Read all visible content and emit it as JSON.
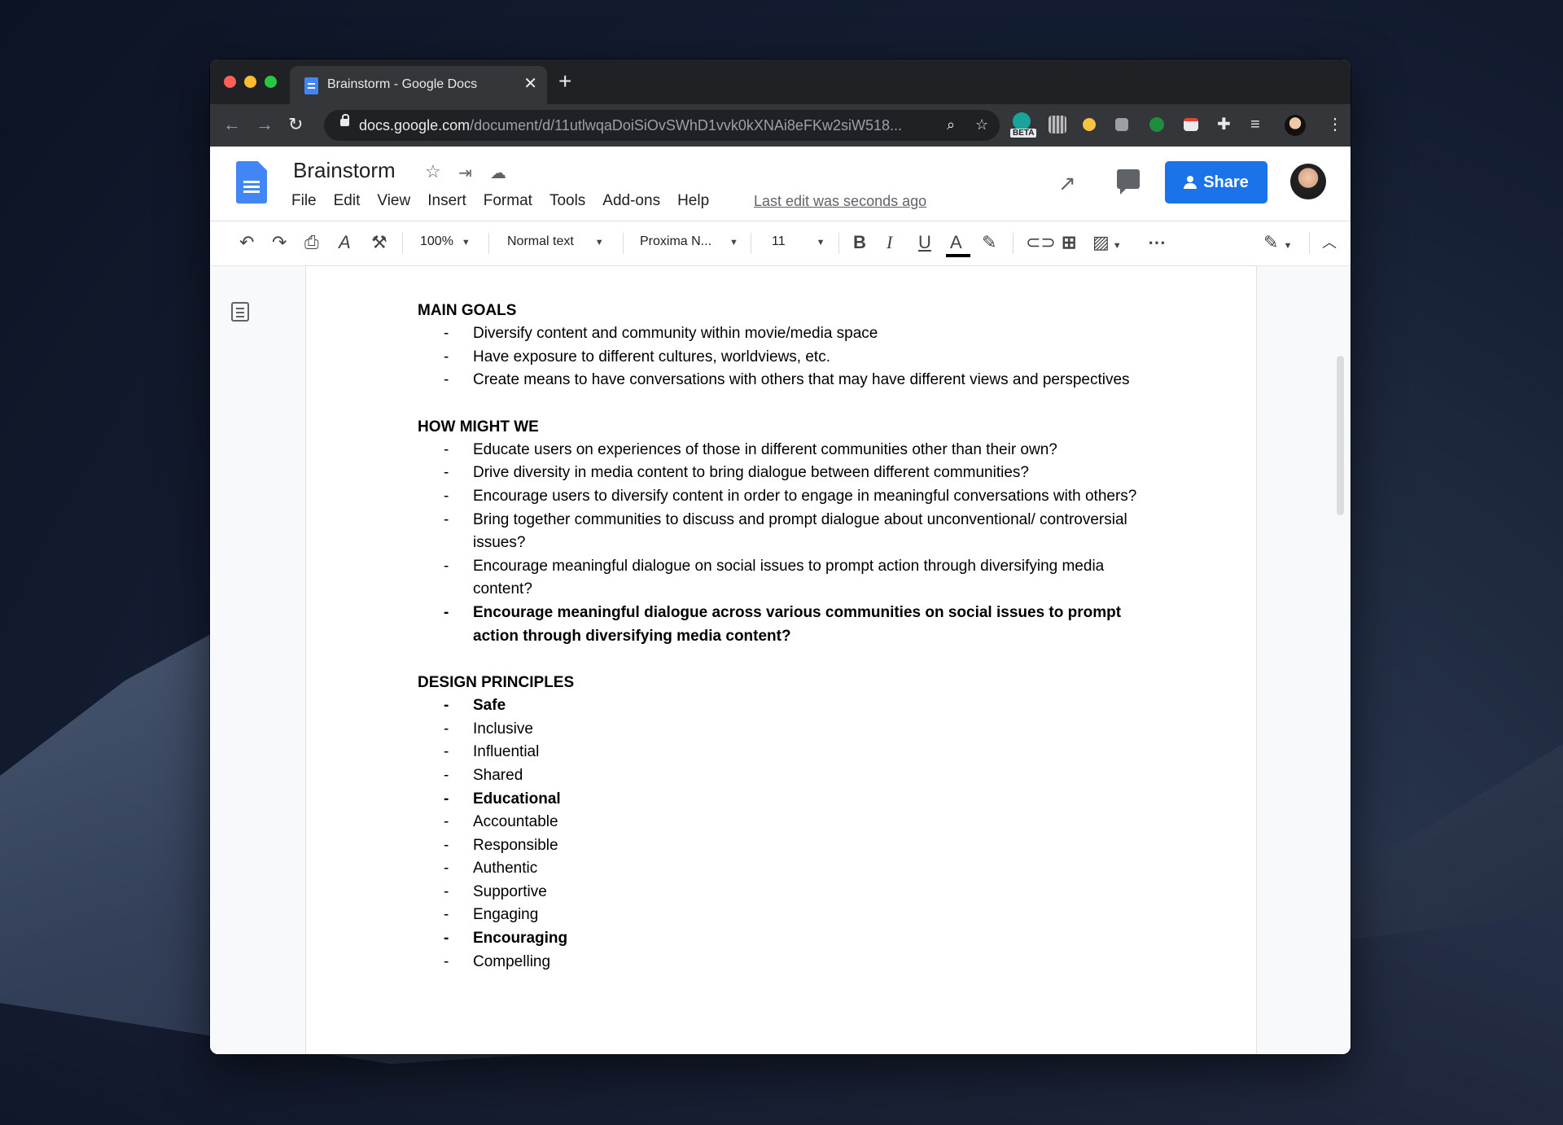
{
  "browser": {
    "tab_title": "Brainstorm - Google Docs",
    "url_host": "docs.google.com",
    "url_path": "/document/d/11utlwqaDoiSiOvSWhD1vvk0kXNAi8eFKw2siW518...",
    "beta_label": "BETA"
  },
  "docs": {
    "title": "Brainstorm",
    "menu": [
      "File",
      "Edit",
      "View",
      "Insert",
      "Format",
      "Tools",
      "Add-ons",
      "Help"
    ],
    "last_edit": "Last edit was seconds ago",
    "share_label": "Share",
    "accent_color": "#1a73e8"
  },
  "toolbar": {
    "zoom": "100%",
    "style": "Normal text",
    "font": "Proxima N...",
    "size": "11"
  },
  "document": {
    "sections": [
      {
        "heading": "MAIN GOALS",
        "items": [
          {
            "text": "Diversify content and community within movie/media space",
            "bold": false
          },
          {
            "text": "Have exposure to different cultures, worldviews, etc.",
            "bold": false
          },
          {
            "text": "Create means to have conversations with others that may have different views and perspectives",
            "bold": false
          }
        ]
      },
      {
        "heading": "HOW MIGHT WE",
        "items": [
          {
            "text": "Educate users on experiences of those in different communities other than their own?",
            "bold": false
          },
          {
            "text": "Drive diversity in media content to bring dialogue between different communities?",
            "bold": false
          },
          {
            "text": "Encourage users to diversify content in order to engage in meaningful conversations with others?",
            "bold": false
          },
          {
            "text": "Bring together communities to discuss and prompt dialogue about unconventional/ controversial issues?",
            "bold": false
          },
          {
            "text": "Encourage meaningful dialogue on social issues to prompt action through diversifying media content?",
            "bold": false
          },
          {
            "text": "Encourage meaningful dialogue across various communities on social issues to prompt action through diversifying media content?",
            "bold": true
          }
        ]
      },
      {
        "heading": "DESIGN PRINCIPLES",
        "items": [
          {
            "text": "Safe",
            "bold": true
          },
          {
            "text": "Inclusive",
            "bold": false
          },
          {
            "text": "Influential",
            "bold": false
          },
          {
            "text": "Shared",
            "bold": false
          },
          {
            "text": "Educational",
            "bold": true
          },
          {
            "text": "Accountable",
            "bold": false
          },
          {
            "text": "Responsible",
            "bold": false
          },
          {
            "text": "Authentic",
            "bold": false
          },
          {
            "text": "Supportive",
            "bold": false
          },
          {
            "text": "Engaging",
            "bold": false
          },
          {
            "text": "Encouraging",
            "bold": true
          },
          {
            "text": "Compelling",
            "bold": false
          }
        ]
      }
    ]
  }
}
